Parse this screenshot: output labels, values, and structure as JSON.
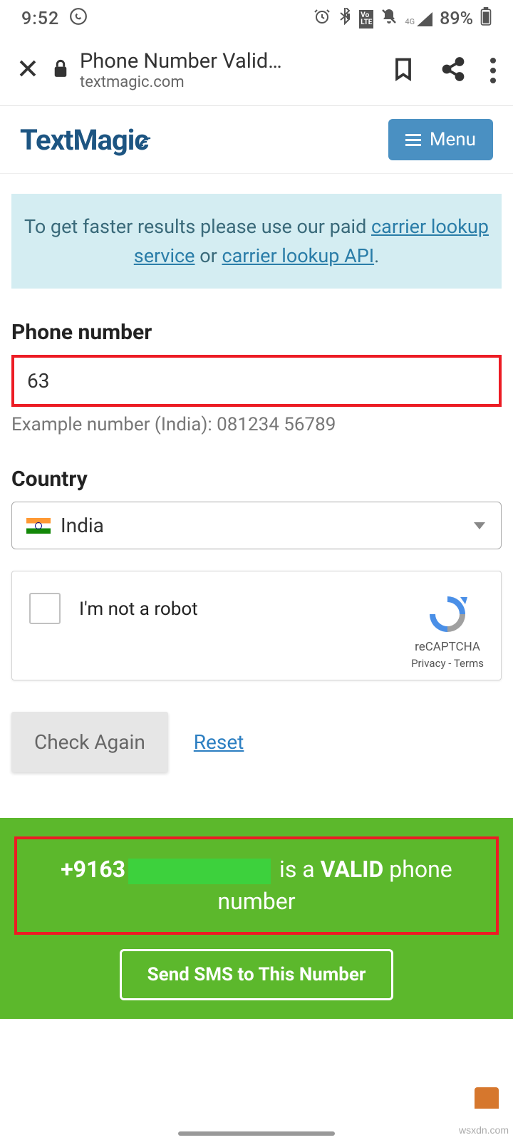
{
  "status": {
    "time": "9:52",
    "battery": "89%"
  },
  "browser": {
    "title": "Phone Number Valid…",
    "domain": "textmagic.com"
  },
  "header": {
    "logo": "TextMagic",
    "menu": "Menu"
  },
  "notice": {
    "pre": "To get faster results please use our paid ",
    "link1": "carrier lookup service",
    "mid": " or ",
    "link2": "carrier lookup API",
    "post": "."
  },
  "form": {
    "phone_label": "Phone number",
    "phone_value": "63",
    "example": "Example number (India): 081234 56789",
    "country_label": "Country",
    "country_value": "India"
  },
  "captcha": {
    "label": "I'm not a robot",
    "brand": "reCAPTCHA",
    "links": "Privacy - Terms"
  },
  "actions": {
    "check": "Check Again",
    "reset": "Reset"
  },
  "result": {
    "prefix": "+9163",
    "mid": " is a ",
    "valid": "VALID",
    "suffix": " phone number",
    "send": "Send SMS to This Number"
  },
  "watermark": "wsxdn.com"
}
